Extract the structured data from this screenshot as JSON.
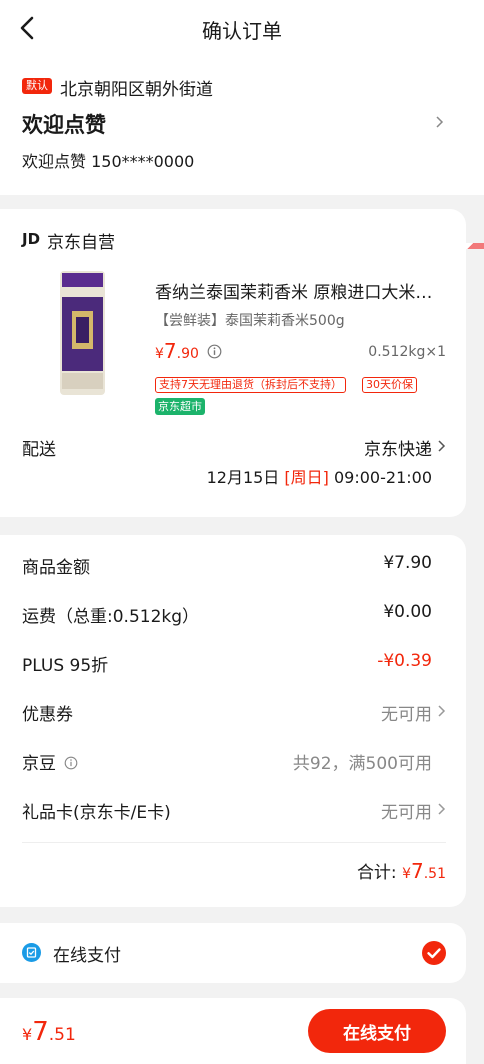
{
  "header": {
    "title": "确认订单"
  },
  "address": {
    "default_badge": "默认",
    "region": "北京朝阳区朝外街道",
    "name": "欢迎点赞",
    "contact": "欢迎点赞 150****0000"
  },
  "shop": {
    "logo": "JD",
    "name": "京东自营",
    "product": {
      "title": "香纳兰泰国茉莉香米 原粮进口大米…",
      "spec": "【尝鲜装】泰国茉莉香米500g",
      "price_symbol": "¥",
      "price_int": "7",
      "price_dec": ".90",
      "qty": "0.512kg×1",
      "tags": [
        "支持7天无理由退货（拆封后不支持）",
        "30天价保"
      ],
      "super_tag": "京东超市"
    },
    "delivery": {
      "label": "配送",
      "method": "京东快递",
      "date": "12月15日",
      "weekday": "[周日]",
      "time": "09:00-21:00"
    }
  },
  "fees": {
    "rows": [
      {
        "label": "商品金额",
        "value": "¥7.90"
      },
      {
        "label": "运费（总重:0.512kg）",
        "value": "¥0.00"
      },
      {
        "label": "PLUS 95折",
        "value": "-¥0.39"
      },
      {
        "label": "优惠券",
        "value": "无可用"
      },
      {
        "label": "京豆",
        "value": "共92，满500可用"
      },
      {
        "label": "礼品卡(京东卡/E卡)",
        "value": "无可用"
      }
    ],
    "total_label": "合计:",
    "total_symbol": "¥",
    "total_int": "7",
    "total_dec": ".51"
  },
  "payment": {
    "method": "在线支付"
  },
  "bottom": {
    "price_symbol": "¥",
    "price_int": "7",
    "price_dec": ".51",
    "pay_button": "在线支付"
  },
  "colors": {
    "accent": "#f2270c",
    "super_green": "#1cb36b",
    "pay_icon_blue": "#1a9be6"
  }
}
